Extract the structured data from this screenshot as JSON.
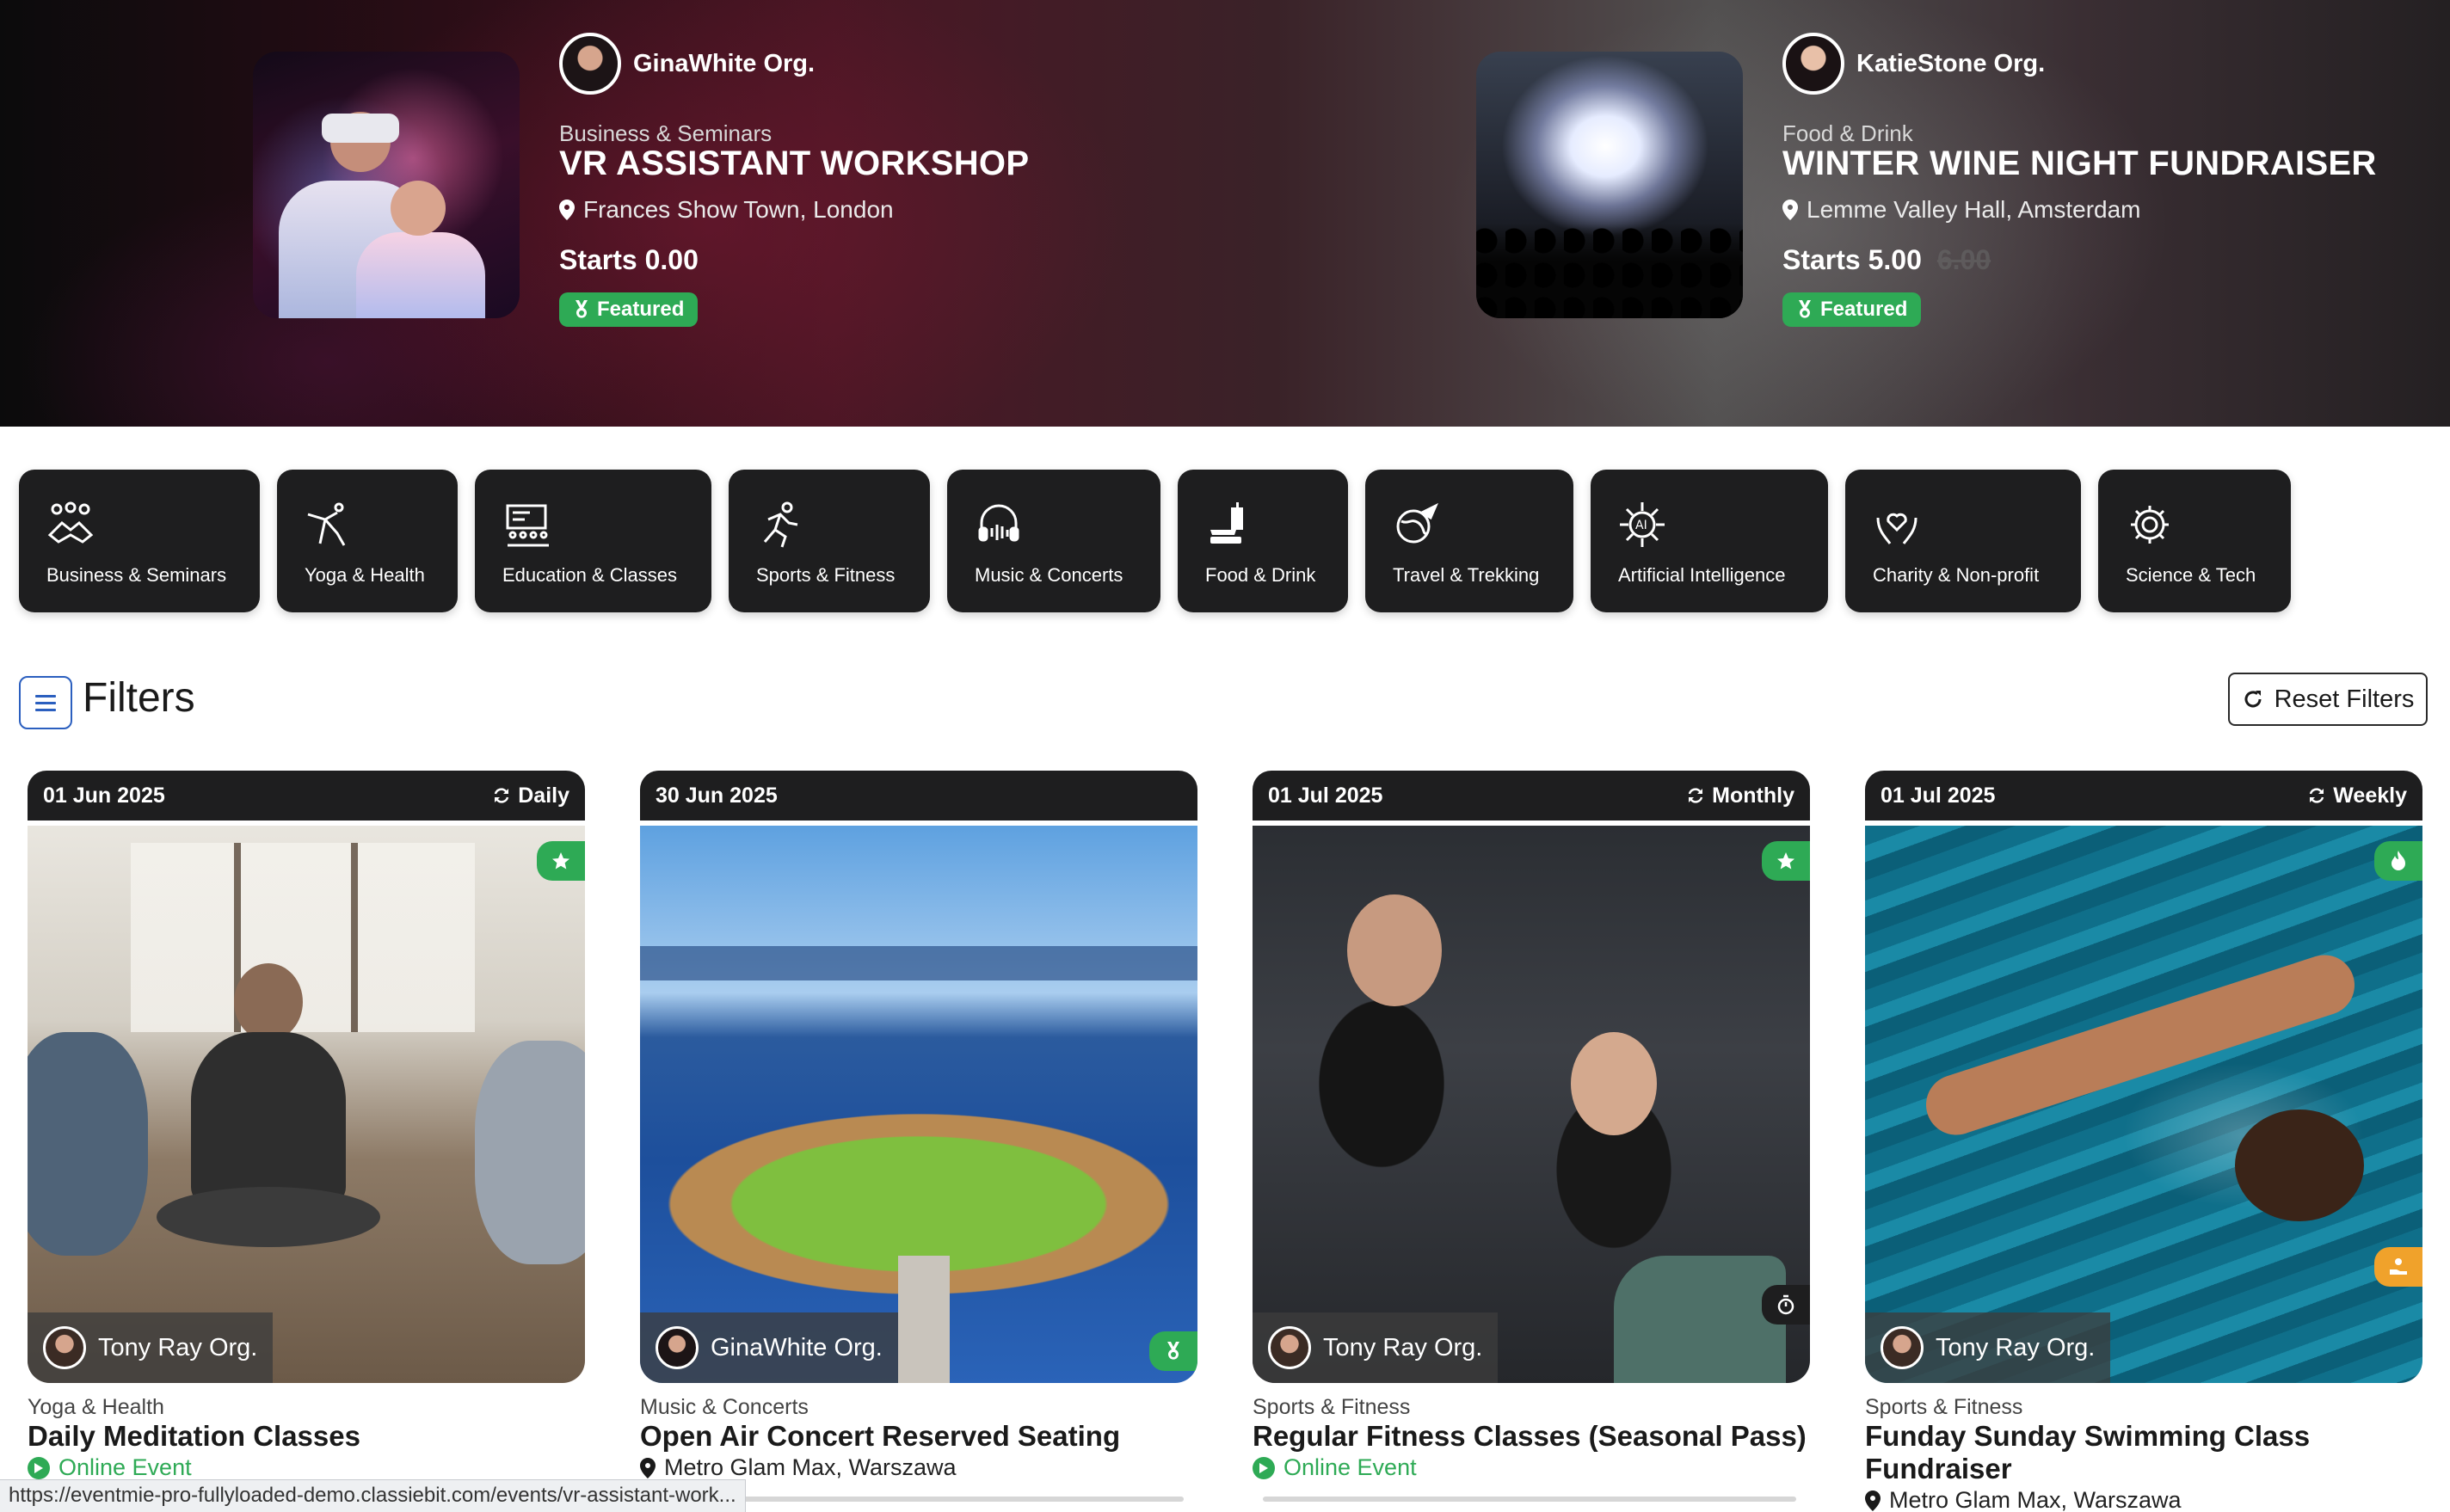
{
  "hero": {
    "items": [
      {
        "org": "GinaWhite Org.",
        "category": "Business & Seminars",
        "title": "VR ASSISTANT WORKSHOP",
        "venue": "Frances Show Town, London",
        "price": "Starts 0.00",
        "old_price": "",
        "badge": "Featured"
      },
      {
        "org": "KatieStone Org.",
        "category": "Food & Drink",
        "title": "WINTER WINE NIGHT FUNDRAISER",
        "venue": "Lemme Valley Hall, Amsterdam",
        "price": "Starts 5.00",
        "old_price": "6.00",
        "badge": "Featured"
      }
    ]
  },
  "categories": [
    {
      "label": "Business & Seminars",
      "icon": "handshake-icon"
    },
    {
      "label": "Yoga & Health",
      "icon": "yoga-icon"
    },
    {
      "label": "Education & Classes",
      "icon": "classroom-icon"
    },
    {
      "label": "Sports & Fitness",
      "icon": "runner-icon"
    },
    {
      "label": "Music & Concerts",
      "icon": "headphones-icon"
    },
    {
      "label": "Food & Drink",
      "icon": "fast-food-icon"
    },
    {
      "label": "Travel & Trekking",
      "icon": "globe-plane-icon"
    },
    {
      "label": "Artificial Intelligence",
      "icon": "ai-chip-icon"
    },
    {
      "label": "Charity & Non-profit",
      "icon": "heart-hands-icon"
    },
    {
      "label": "Science & Tech",
      "icon": "gear-globe-icon"
    }
  ],
  "filters": {
    "title": "Filters",
    "reset_label": "Reset Filters"
  },
  "events": [
    {
      "date": "01 Jun 2025",
      "repeat": "Daily",
      "org": "Tony Ray Org.",
      "category": "Yoga & Health",
      "title": "Daily Meditation Classes",
      "location": "Online Event",
      "online": true
    },
    {
      "date": "30 Jun 2025",
      "repeat": "",
      "org": "GinaWhite Org.",
      "category": "Music & Concerts",
      "title": "Open Air Concert Reserved Seating",
      "location": "Metro Glam Max, Warszawa",
      "online": false
    },
    {
      "date": "01 Jul 2025",
      "repeat": "Monthly",
      "org": "Tony Ray Org.",
      "category": "Sports & Fitness",
      "title": "Regular Fitness Classes (Seasonal Pass)",
      "location": "Online Event",
      "online": true
    },
    {
      "date": "01 Jul 2025",
      "repeat": "Weekly",
      "org": "Tony Ray Org.",
      "category": "Sports & Fitness",
      "title": "Funday Sunday Swimming Class Fundraiser",
      "location": "Metro Glam Max, Warszawa",
      "online": false
    }
  ],
  "status_url": "https://eventmie-pro-fullyloaded-demo.classiebit.com/events/vr-assistant-work...",
  "colors": {
    "accent_green": "#2eaa55",
    "dark_tile": "#1e1e1f",
    "filter_blue": "#2b5fbf",
    "orange_badge": "#f0a22b"
  }
}
